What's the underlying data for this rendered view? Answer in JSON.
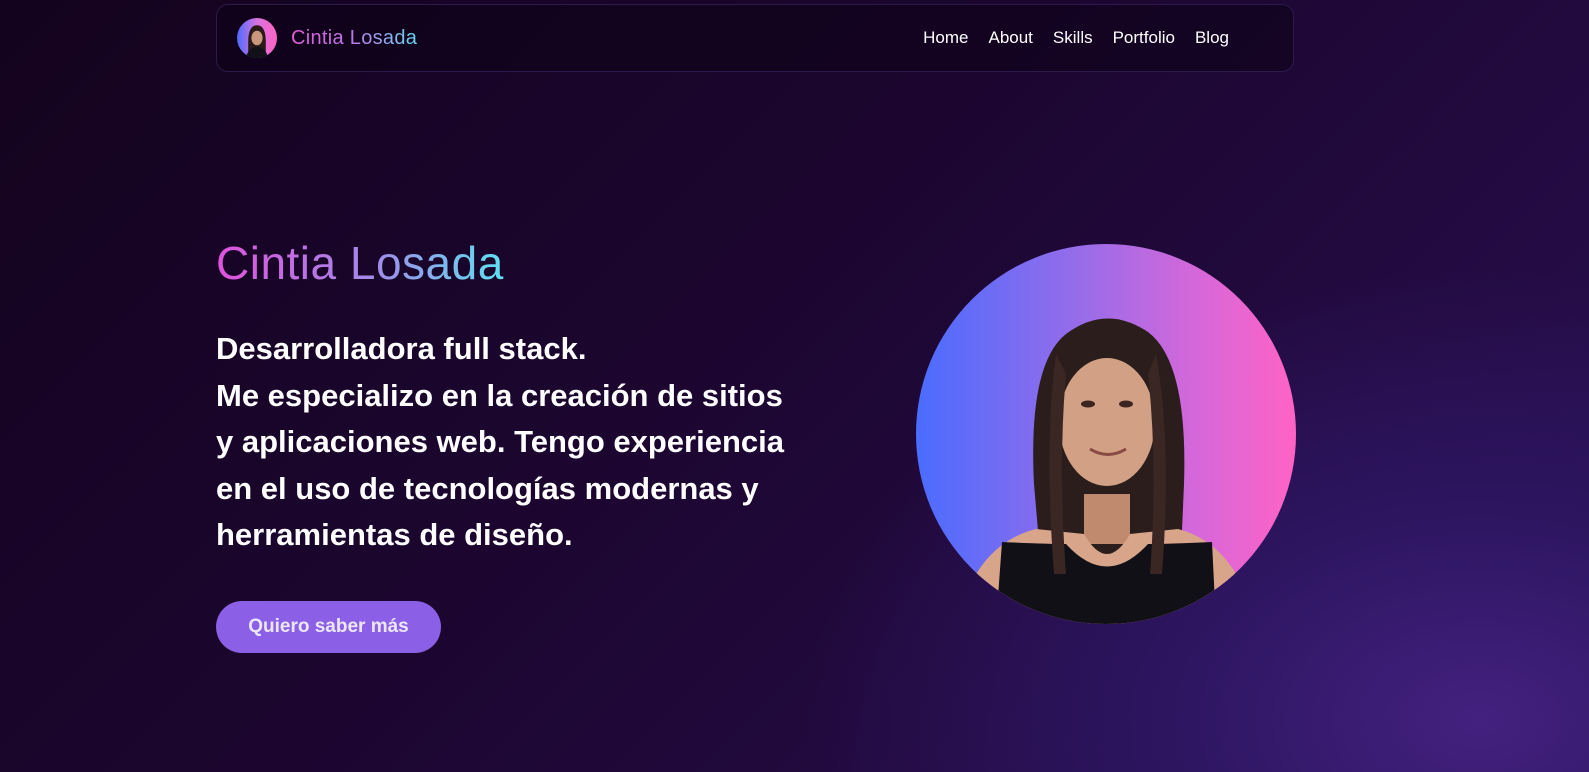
{
  "nav": {
    "brand": "Cintia Losada",
    "links": [
      "Home",
      "About",
      "Skills",
      "Portfolio",
      "Blog"
    ]
  },
  "hero": {
    "name": "Cintia Losada",
    "lines": [
      "Desarrolladora full stack.",
      "Me especializo en la creación de sitios",
      "y aplicaciones web. Tengo experiencia",
      "en el uso de tecnologías modernas y",
      "herramientas de diseño."
    ],
    "cta": "Quiero saber más"
  },
  "colors": {
    "accent": "#8c60e6",
    "gradient_start": "#e052dc",
    "gradient_end": "#5fe0f2",
    "portrait_left": "#4a6cff",
    "portrait_right": "#ff63c4"
  }
}
